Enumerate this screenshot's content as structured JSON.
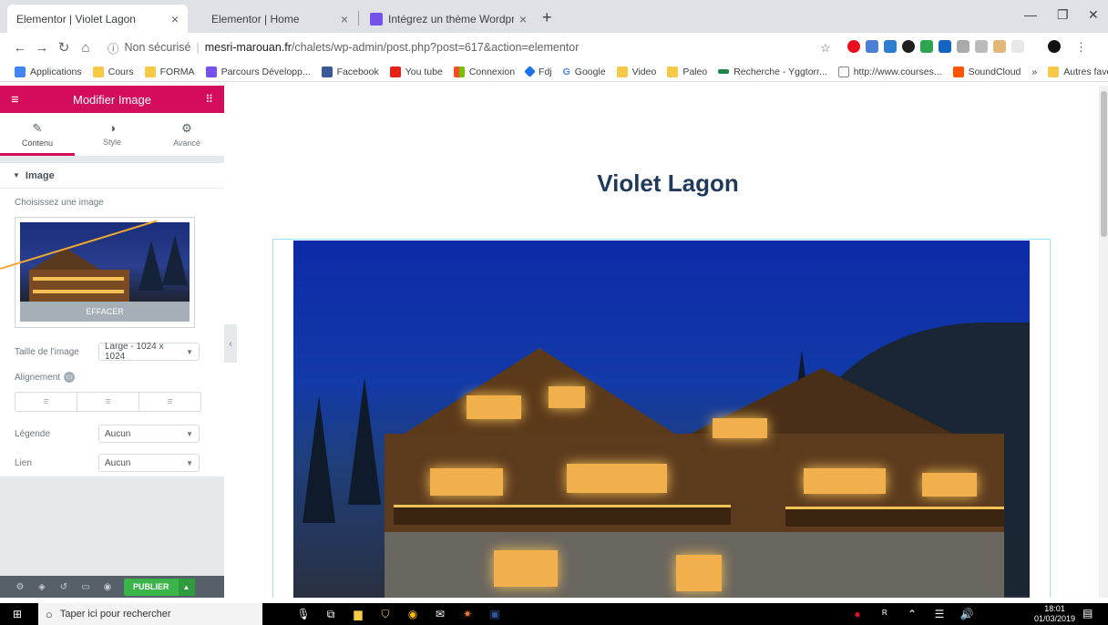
{
  "browser": {
    "tabs": [
      {
        "title": "Elementor | Violet Lagon",
        "active": true
      },
      {
        "title": "Elementor | Home",
        "active": false
      },
      {
        "title": "Intégrez un thème Wordpress po",
        "active": false
      }
    ],
    "url_security": "Non sécurisé",
    "url_host": "mesri-marouan.fr",
    "url_path": "/chalets/wp-admin/post.php?post=617&action=elementor",
    "bookmarks": [
      "Applications",
      "Cours",
      "FORMA",
      "Parcours Développ...",
      "Facebook",
      "You tube",
      "Connexion",
      "Fdj",
      "Google",
      "Video",
      "Paleo",
      "Recherche - Yggtorr...",
      "http://www.courses...",
      "SoundCloud",
      "»",
      "Autres favoris"
    ]
  },
  "panel": {
    "title": "Modifier Image",
    "tabs": [
      {
        "label": "Contenu",
        "icon": "pencil-icon"
      },
      {
        "label": "Style",
        "icon": "contrast-icon"
      },
      {
        "label": "Avancé",
        "icon": "gear-icon"
      }
    ],
    "section_title": "Image",
    "choose_label": "Choisissez une image",
    "clear_label": "EFFACER",
    "size_label": "Taille de l'image",
    "size_value": "Large - 1024 x 1024",
    "alignment_label": "Alignement",
    "caption_label": "Légende",
    "caption_value": "Aucun",
    "link_label": "Lien",
    "link_value": "Aucun",
    "publish_label": "PUBLIER"
  },
  "preview": {
    "title": "Violet Lagon"
  },
  "taskbar": {
    "search_placeholder": "Taper ici pour rechercher",
    "time": "18:01",
    "date": "01/03/2019"
  },
  "colors": {
    "elementor_accent": "#d30c5c",
    "publish_green": "#39b54a",
    "heading": "#1f3a5a"
  }
}
